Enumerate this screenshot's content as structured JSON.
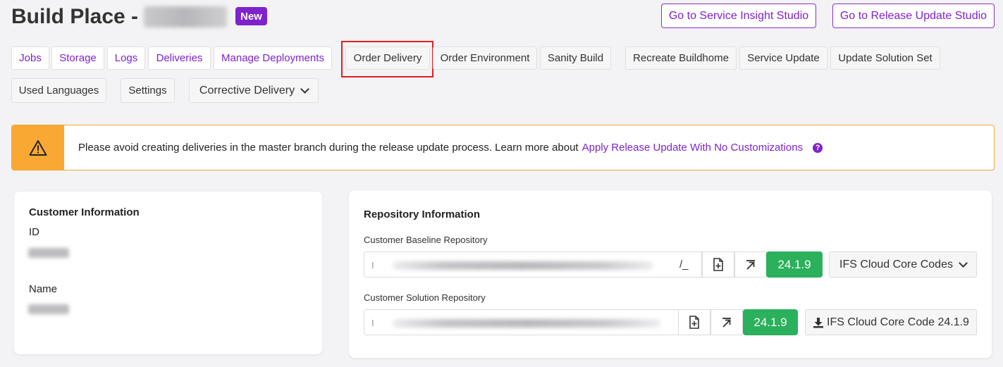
{
  "header": {
    "title_prefix": "Build Place -",
    "badge": "New",
    "service_insight_label": "Go to Service Insight Studio",
    "release_update_label": "Go to Release Update Studio"
  },
  "tabs": {
    "row1": [
      "Jobs",
      "Storage",
      "Logs",
      "Deliveries",
      "Manage Deployments",
      "Order Delivery",
      "Order Environment",
      "Sanity Build",
      "Recreate Buildhome",
      "Service Update",
      "Update Solution Set"
    ],
    "row2": [
      "Used Languages",
      "Settings",
      "Corrective Delivery"
    ]
  },
  "warning": {
    "text": "Please avoid creating deliveries in the master branch during the release update process. Learn more about",
    "link": "Apply Release Update With No Customizations",
    "help": "?"
  },
  "customer": {
    "title": "Customer Information",
    "id_label": "ID",
    "name_label": "Name"
  },
  "repository": {
    "title": "Repository Information",
    "baseline_label": "Customer Baseline Repository",
    "baseline_prefix": "I",
    "baseline_suffix": "/_",
    "baseline_version": "24.1.9",
    "baseline_dropdown": "IFS Cloud Core Codes",
    "solution_label": "Customer Solution Repository",
    "solution_prefix": "I",
    "solution_version": "24.1.9",
    "solution_download": "IFS Cloud Core Code 24.1.9"
  },
  "colors": {
    "accent": "#7e22ce",
    "warning": "#f9a834",
    "success": "#2bb05c",
    "highlight": "#e02020"
  }
}
